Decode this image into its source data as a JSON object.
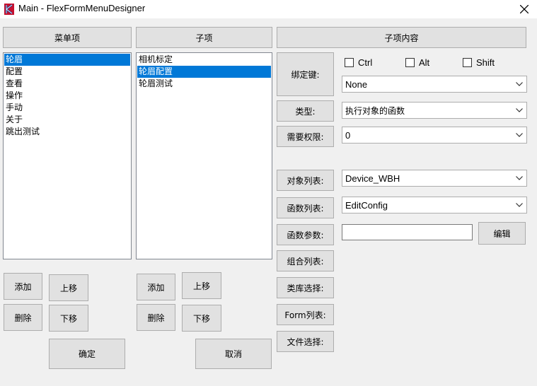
{
  "window": {
    "title": "Main - FlexFormMenuDesigner"
  },
  "menu_column": {
    "header": "菜单项",
    "items": [
      "轮眉",
      "配置",
      "查看",
      "操作",
      "手动",
      "关于",
      "跳出测试"
    ],
    "selected_index": 0,
    "add_label": "添加",
    "up_label": "上移",
    "delete_label": "删除",
    "down_label": "下移",
    "ok_label": "确定"
  },
  "sub_column": {
    "header": "子项",
    "items": [
      "相机标定",
      "轮眉配置",
      "轮眉测试"
    ],
    "selected_index": 1,
    "add_label": "添加",
    "up_label": "上移",
    "delete_label": "删除",
    "down_label": "下移",
    "cancel_label": "取消"
  },
  "content": {
    "header": "子项内容",
    "bind_key_label": "绑定键:",
    "ctrl_label": "Ctrl",
    "alt_label": "Alt",
    "shift_label": "Shift",
    "ctrl_checked": false,
    "alt_checked": false,
    "shift_checked": false,
    "key_value": "None",
    "type_label": "类型:",
    "type_value": "执行对象的函数",
    "permission_label": "需要权限:",
    "permission_value": "0",
    "object_list_label": "对象列表:",
    "object_value": "Device_WBH",
    "function_list_label": "函数列表:",
    "function_value": "EditConfig",
    "function_params_label": "函数参数:",
    "function_params_value": "",
    "edit_label": "编辑",
    "combo_list_label": "组合列表:",
    "class_lib_label": "类库选择:",
    "form_list_label": "Form列表:",
    "file_select_label": "文件选择:"
  }
}
